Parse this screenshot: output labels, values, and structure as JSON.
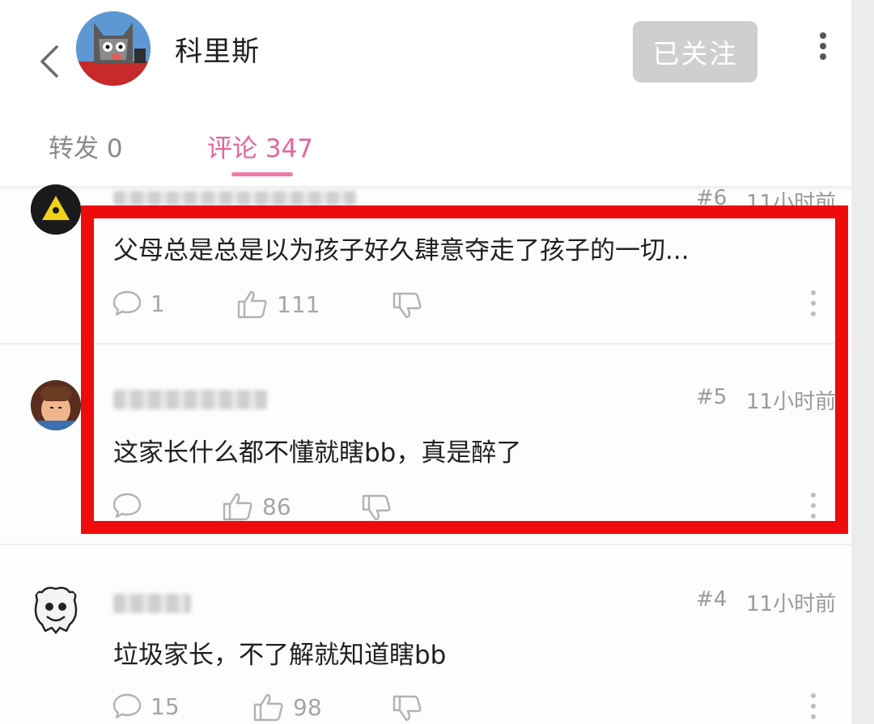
{
  "header": {
    "username": "科里斯",
    "follow_label": "已关注",
    "tabs": [
      {
        "label": "转发 0",
        "active": false
      },
      {
        "label": "评论 347",
        "active": true
      }
    ]
  },
  "comments": [
    {
      "floor": "#6",
      "time": "11小时前",
      "text": "父母总是总是以为孩子好久肆意夺走了孩子的一切...",
      "reply_count": "1",
      "like_count": "111"
    },
    {
      "floor": "#5",
      "time": "11小时前",
      "text": "这家长什么都不懂就瞎bb，真是醉了",
      "reply_count": "",
      "like_count": "86"
    },
    {
      "floor": "#4",
      "time": "11小时前",
      "text": "垃圾家长，不了解就知道瞎bb",
      "reply_count": "15",
      "like_count": "98"
    }
  ],
  "colors": {
    "accent": "#e5649b",
    "highlight_box": "#ee0b0b"
  },
  "icons": [
    "back-arrow-icon",
    "more-vertical-icon",
    "comment-bubble-icon",
    "thumbs-up-icon",
    "thumbs-down-icon"
  ]
}
